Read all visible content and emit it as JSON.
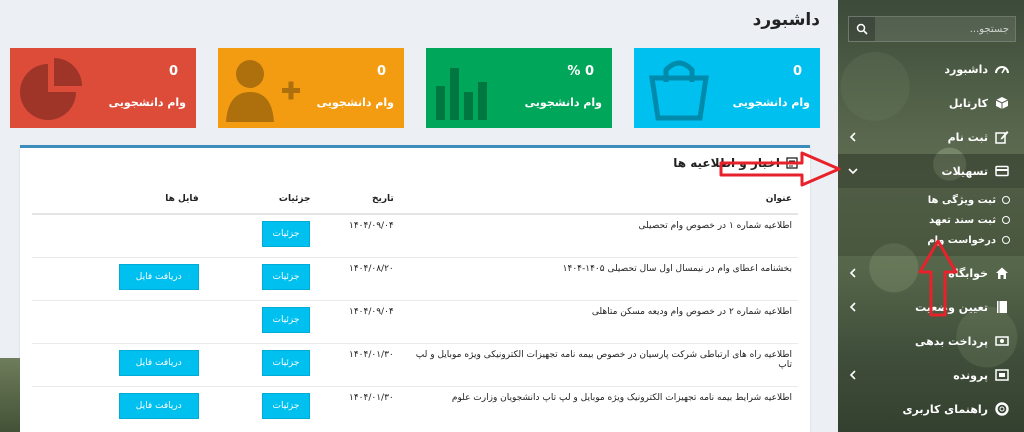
{
  "header": {
    "title": "داشبورد"
  },
  "sidebar": {
    "search_placeholder": "جستجو...",
    "items": [
      {
        "label": "داشبورد",
        "icon": "dashboard-icon",
        "has_chevron": false
      },
      {
        "label": "کارتابل",
        "icon": "cube-icon",
        "has_chevron": false
      },
      {
        "label": "ثبت نام",
        "icon": "edit-icon",
        "has_chevron": true
      },
      {
        "label": "تسهیلات",
        "icon": "credit-card-icon",
        "has_chevron": true,
        "active": true
      },
      {
        "label": "خوابگاه",
        "icon": "home-icon",
        "has_chevron": true
      },
      {
        "label": "تعیین وضعیت",
        "icon": "book-icon",
        "has_chevron": true
      },
      {
        "label": "پرداخت بدهی",
        "icon": "money-icon",
        "has_chevron": false
      },
      {
        "label": "پرونده",
        "icon": "folder-icon",
        "has_chevron": true
      },
      {
        "label": "راهنمای کاربری",
        "icon": "help-icon",
        "has_chevron": false
      }
    ],
    "submenu": [
      {
        "label": "ثبت ویژگی ها"
      },
      {
        "label": "ثبت سند تعهد"
      },
      {
        "label": "درخواست وام"
      }
    ]
  },
  "cards": [
    {
      "value": "0",
      "label": "وام دانشجویی",
      "color": "#00c0ef",
      "icon": "shopping-bag-icon"
    },
    {
      "value": "0 %",
      "label": "وام دانشجویی",
      "color": "#00a65a",
      "icon": "bar-chart-icon"
    },
    {
      "value": "0",
      "label": "وام دانشجویی",
      "color": "#f39c12",
      "icon": "user-add-icon"
    },
    {
      "value": "0",
      "label": "وام دانشجویی",
      "color": "#dd4b39",
      "icon": "pie-chart-icon"
    }
  ],
  "news": {
    "title": "اخبار و اطلاعیه ها",
    "columns": {
      "title": "عنوان",
      "date": "تاریخ",
      "details": "جزئیات",
      "files": "فایل ها"
    },
    "details_label": "جزئیات",
    "file_label": "دریافت فایل",
    "rows": [
      {
        "title": "اطلاعیه شماره ۱ در خصوص وام تحصیلی",
        "date": "۱۴۰۴/۰۹/۰۴",
        "has_file": false
      },
      {
        "title": "بخشنامه اعطای وام در نیمسال اول سال تحصیلی ۱۴۰۵-۱۴۰۴",
        "date": "۱۴۰۴/۰۸/۲۰",
        "has_file": true
      },
      {
        "title": "اطلاعیه شماره ۲ در خصوص وام ودیعه مسکن متاهلی",
        "date": "۱۴۰۴/۰۹/۰۴",
        "has_file": false
      },
      {
        "title": "اطلاعیه راه های ارتباطی شرکت پارسیان در خصوص بیمه نامه تجهیزات الکترونیکی ویژه موبایل و لپ تاپ",
        "date": "۱۴۰۴/۰۱/۳۰",
        "has_file": true
      },
      {
        "title": "اطلاعیه شرایط بیمه نامه تجهیزات الکترونیک ویژه موبایل و لپ تاپ دانشجویان وزارت علوم",
        "date": "۱۴۰۴/۰۱/۳۰",
        "has_file": true
      }
    ]
  },
  "colors": {
    "accent": "#00c0ef",
    "box_border": "#3c8dbc",
    "arrow": "#e8222a"
  }
}
